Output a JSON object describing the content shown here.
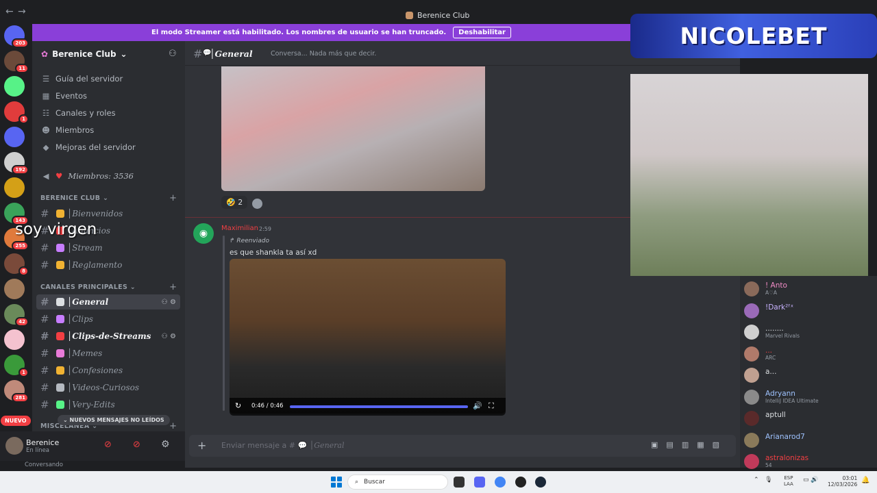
{
  "window": {
    "title": "Berenice Club"
  },
  "banner": {
    "text": "El modo Streamer está habilitado. Los nombres de usuario se han truncado.",
    "button": "Deshabilitar"
  },
  "servers": [
    {
      "name": "discord-home",
      "badge": "203",
      "color": "#5865f2"
    },
    {
      "name": "server-2",
      "badge": "11",
      "color": "#6b4a3a"
    },
    {
      "name": "server-3",
      "badge": "",
      "color": "#57f287"
    },
    {
      "name": "server-4",
      "badge": "1",
      "color": "#e03c3c"
    },
    {
      "name": "server-5",
      "badge": "",
      "color": "#5865f2"
    },
    {
      "name": "server-6",
      "badge": "192",
      "color": "#cfcfcf"
    },
    {
      "name": "server-7",
      "badge": "",
      "color": "#d4a017"
    },
    {
      "name": "server-8",
      "badge": "143",
      "color": "#3aa35a"
    },
    {
      "name": "server-9",
      "badge": "255",
      "color": "#e07a3c"
    },
    {
      "name": "server-10",
      "badge": "8",
      "color": "#7a4a3a"
    },
    {
      "name": "server-11",
      "badge": "",
      "color": "#a07a5a"
    },
    {
      "name": "server-12",
      "badge": "42",
      "color": "#6a8a5a"
    },
    {
      "name": "server-13",
      "badge": "",
      "color": "#f4c2cf"
    },
    {
      "name": "server-14",
      "badge": "1",
      "color": "#3a9a3a"
    },
    {
      "name": "server-15",
      "badge": "281",
      "color": "#c08a7a"
    }
  ],
  "nuevo": "NUEVO",
  "server": {
    "name": "Berenice Club"
  },
  "menu": [
    {
      "label": "Guía del servidor",
      "icon": "☰"
    },
    {
      "label": "Eventos",
      "icon": "▦"
    },
    {
      "label": "Canales y roles",
      "icon": "☷"
    },
    {
      "label": "Miembros",
      "icon": "☻"
    },
    {
      "label": "Mejoras del servidor",
      "icon": "◆"
    }
  ],
  "member_count": {
    "label": "Miembros",
    "value": "3536"
  },
  "categories": {
    "berenice": "BERENICE CLUB",
    "principales": "CANALES PRINCIPALES",
    "misc": "MISCELÁNEA"
  },
  "channels_berenice": [
    {
      "name": "Bienvenidos",
      "color": "#f0b232"
    },
    {
      "name": "Anuncios",
      "color": "#f23f43"
    },
    {
      "name": "Stream",
      "color": "#c77dff"
    },
    {
      "name": "Reglamento",
      "color": "#f0b232"
    }
  ],
  "channels_main": [
    {
      "name": "General",
      "color": "#dbdee1"
    },
    {
      "name": "Clips",
      "color": "#c77dff"
    },
    {
      "name": "Clips-de-Streams",
      "color": "#f23f43"
    },
    {
      "name": "Memes",
      "color": "#e87bd8"
    },
    {
      "name": "Confesiones",
      "color": "#f0b232"
    },
    {
      "name": "Videos-Curiosos",
      "color": "#b5bac1"
    },
    {
      "name": "Very-Edits",
      "color": "#57f287"
    }
  ],
  "unread": "NUEVOS MENSAJES NO LEÍDOS",
  "overlay_text": "soy virgen",
  "user": {
    "name": "Berenice",
    "status": "En línea",
    "activity": "Conversando"
  },
  "channel": {
    "name": "General",
    "topic": "Conversa... Nada más que decir."
  },
  "reaction": {
    "count": "2"
  },
  "message": {
    "author": "Maximilian",
    "time": "2:59",
    "forwarded": "Reenviado",
    "text": "es que shankla ta así xd",
    "video_time": "0:46 / 0:46"
  },
  "composer": {
    "placeholder": "Enviar mensaje a #",
    "channel": "General"
  },
  "members": [
    {
      "name": "! Anto",
      "sub": "A♡A",
      "color": "#f28cc6"
    },
    {
      "name": "!Dark²ᶠˣ",
      "sub": "",
      "color": "#c9b3ff"
    },
    {
      "name": "........",
      "sub": "Marvel Rivals",
      "color": "#dbdee1"
    },
    {
      "name": "...",
      "sub": "ARC",
      "color": "#f23f43"
    },
    {
      "name": "a...",
      "sub": "",
      "color": "#dbdee1"
    },
    {
      "name": "Adryann",
      "sub": "IntelliJ IDEA Ultimate",
      "color": "#9fc3ff"
    },
    {
      "name": "aptull",
      "sub": "",
      "color": "#dbdee1"
    },
    {
      "name": "Arianarod7",
      "sub": "",
      "color": "#9fc3ff"
    },
    {
      "name": "astralonizas",
      "sub": "54",
      "color": "#f23f43"
    }
  ],
  "stream_logo": "NICOLEBET",
  "taskbar": {
    "search": "Buscar",
    "lang_top": "ESP",
    "lang_bottom": "LAA",
    "time": "03:01",
    "date": "12/03/2026"
  }
}
